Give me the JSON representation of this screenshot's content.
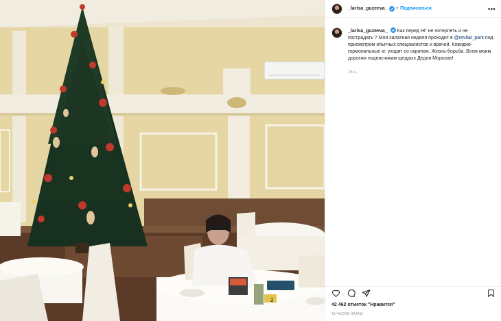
{
  "post": {
    "username": "_larisa_guzeeva_",
    "separator": "•",
    "follow_label": "Подписаться",
    "more_label": "•••",
    "caption": {
      "username": "_larisa_guzeeva_",
      "text_before": "Как перед НГ не потерпеть и не пострадать ? Моя халатная неделя проходит в",
      "mention": "@revital_park",
      "text_after": "под присмотром опытных специалистов и врачей. Ковидно-гормональные кг. уходят со скрипом. Жизнь-борьба. Всем моим дорогим подписчикам щедрых Дедов Морозов!",
      "time": "15 ч."
    },
    "likes_text": "42 462 отметок \"Нравится\"",
    "post_time": "16 ЧАСОВ НАЗАД"
  },
  "icons": {
    "verified": "verified-badge-icon",
    "like": "heart-icon",
    "comment": "comment-icon",
    "share": "paper-plane-icon",
    "save": "bookmark-icon"
  },
  "colors": {
    "link": "#0095f6",
    "mention": "#00376b",
    "verified": "#3897f0",
    "muted": "#8e8e8e"
  },
  "photo": {
    "table_number": "2"
  }
}
